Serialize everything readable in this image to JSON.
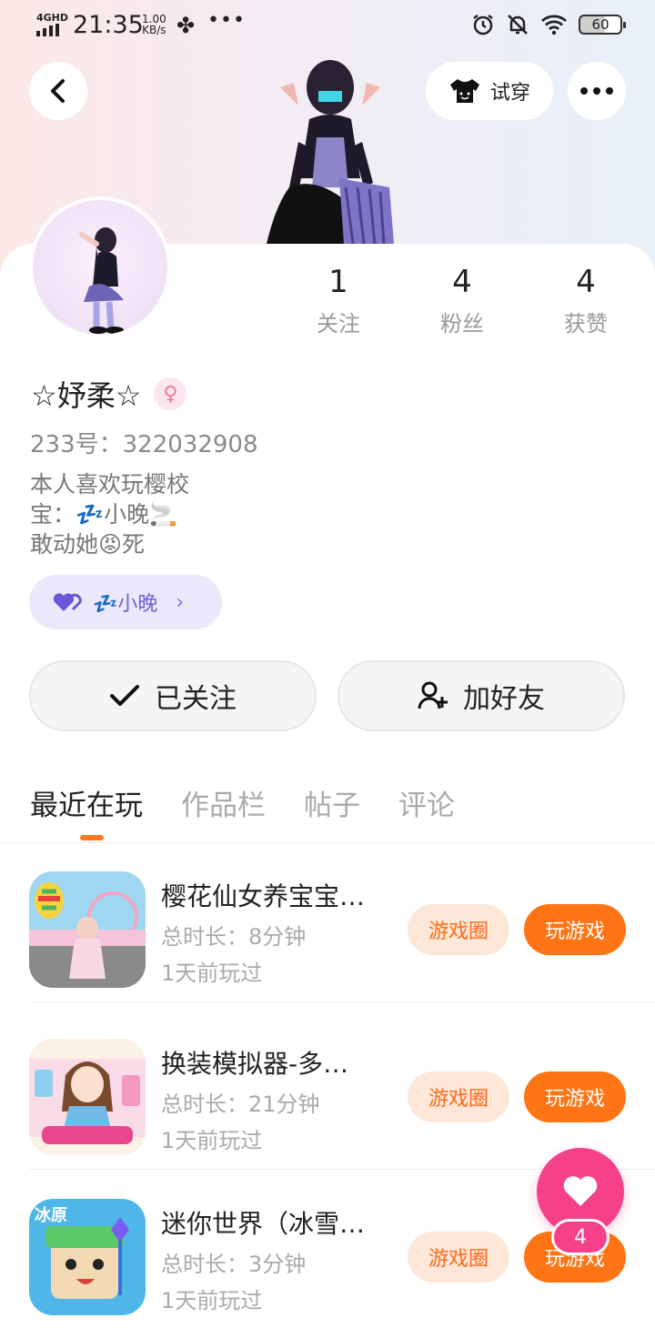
{
  "status_bar": {
    "network": "4GHD",
    "time": "21:35",
    "speed_value": "1.00",
    "speed_unit": "KB/s",
    "battery": "60"
  },
  "header": {
    "try_on_label": "试穿"
  },
  "stats": [
    {
      "value": "1",
      "label": "关注"
    },
    {
      "value": "4",
      "label": "粉丝"
    },
    {
      "value": "4",
      "label": "获赞"
    }
  ],
  "profile": {
    "name": "☆妤柔☆",
    "uid": "233号：322032908",
    "bio_line1": "本人喜欢玩樱校",
    "bio_line2": "宝：💤小晚🚬",
    "bio_line3": "敢动她😡死",
    "cp_name": "💤小晚"
  },
  "actions": {
    "followed_label": "已关注",
    "add_friend_label": "加好友"
  },
  "tabs": [
    "最近在玩",
    "作品栏",
    "帖子",
    "评论"
  ],
  "games": [
    {
      "title": "樱花仙女养宝宝…",
      "duration": "总时长：8分钟",
      "last_played": "1天前玩过",
      "circle_label": "游戏圈",
      "play_label": "玩游戏"
    },
    {
      "title": "换装模拟器-多…",
      "duration": "总时长：21分钟",
      "last_played": "1天前玩过",
      "circle_label": "游戏圈",
      "play_label": "玩游戏"
    },
    {
      "title": "迷你世界（冰雪…",
      "duration": "总时长：3分钟",
      "last_played": "1天前玩过",
      "circle_label": "游戏圈",
      "play_label": "玩游戏"
    }
  ],
  "game3_icon_text": "冰原",
  "fab": {
    "badge": "4"
  }
}
